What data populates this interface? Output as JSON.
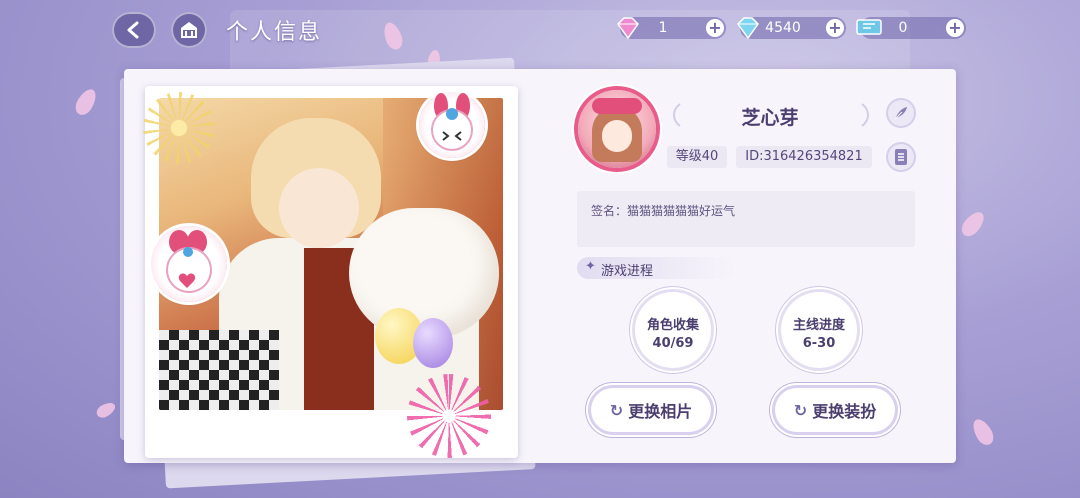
{
  "header": {
    "title": "个人信息",
    "back_icon": "back-arrow-icon",
    "home_icon": "home-building-icon"
  },
  "resources": [
    {
      "name": "pink-gem",
      "icon": "pink-gem-icon",
      "value": "1",
      "color": "#f08ad0"
    },
    {
      "name": "diamond",
      "icon": "diamond-icon",
      "value": "4540",
      "color": "#7fd4f2"
    },
    {
      "name": "ticket",
      "icon": "ticket-icon",
      "value": "0",
      "color": "#6fc7e8"
    }
  ],
  "profile": {
    "name": "芝心芽",
    "level": "等级40",
    "id": "ID:316426354821",
    "signature": "签名：猫猫猫猫猫猫好运气"
  },
  "progress": {
    "section_title": "游戏进程",
    "stats": [
      {
        "label": "角色收集",
        "value": "40/69"
      },
      {
        "label": "主线进度",
        "value": "6-30"
      }
    ]
  },
  "actions": {
    "change_photo": "更换相片",
    "change_outfit": "更换装扮"
  },
  "colors": {
    "accent": "#6f66a6",
    "text": "#4b3f6f",
    "avatar_ring": "#e85b8a"
  }
}
